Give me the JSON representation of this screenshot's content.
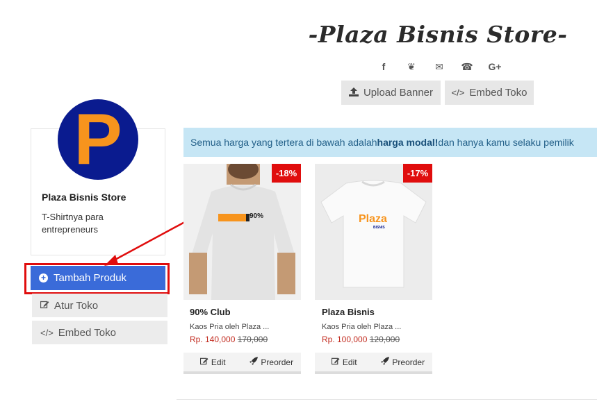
{
  "header": {
    "store_title": "-Plaza Bisnis Store-",
    "social_icons": [
      "facebook-icon",
      "twitter-icon",
      "email-icon",
      "whatsapp-icon",
      "google-plus-icon"
    ],
    "social_glyphs": [
      "f",
      "❦",
      "✉",
      "☎",
      "G+"
    ],
    "upload_banner_label": "Upload Banner",
    "embed_toko_label": "Embed Toko"
  },
  "profile": {
    "avatar_letter": "P",
    "shop_name": "Plaza Bisnis Store",
    "description": "T-Shirtnya para entrepreneurs"
  },
  "sidebar": {
    "add_product_label": "Tambah Produk",
    "manage_store_label": "Atur Toko",
    "embed_store_label": "Embed Toko"
  },
  "info_banner": {
    "text_before": "Semua harga yang tertera di bawah adalah ",
    "text_bold": "harga modal!",
    "text_after": " dan hanya kamu selaku pemilik"
  },
  "products": [
    {
      "discount": "-18%",
      "name": "90% Club",
      "description": "Kaos Pria oleh Plaza ...",
      "price": "Rp. 140,000",
      "old_price": "170,000",
      "print_text": "90%",
      "edit_label": "Edit",
      "preorder_label": "Preorder"
    },
    {
      "discount": "-17%",
      "name": "Plaza Bisnis",
      "description": "Kaos Pria oleh Plaza ...",
      "price": "Rp. 100,000",
      "old_price": "120,000",
      "print_text": "Plaza",
      "print_subtext": "BISNIS",
      "edit_label": "Edit",
      "preorder_label": "Preorder"
    }
  ],
  "colors": {
    "primary_button": "#3a6bd9",
    "highlight_border": "#e00d0d",
    "discount_badge": "#e00d0d",
    "info_background": "#c6e6f5",
    "avatar_background": "#0a1b8f",
    "avatar_letter": "#f7941d"
  }
}
